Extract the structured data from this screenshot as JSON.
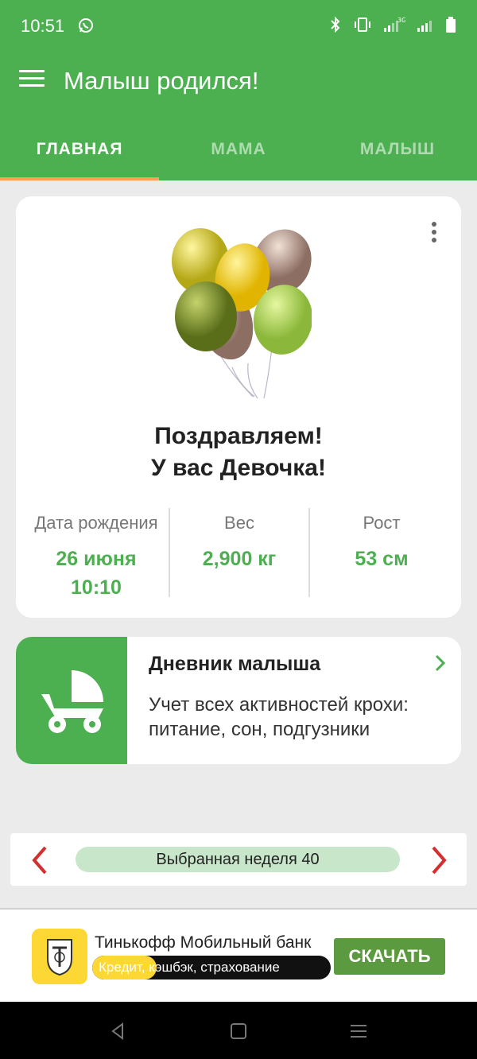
{
  "status_bar": {
    "time": "10:51",
    "icons": [
      "whatsapp-icon",
      "bluetooth-icon",
      "vibrate-icon",
      "signal-3g-icon",
      "signal-icon",
      "battery-icon"
    ]
  },
  "app_bar": {
    "title": "Малыш родился!",
    "menu_icon": "hamburger-menu-icon"
  },
  "tabs": [
    {
      "label": "ГЛАВНАЯ",
      "active": true
    },
    {
      "label": "МАМА",
      "active": false
    },
    {
      "label": "МАЛЫШ",
      "active": false
    }
  ],
  "birth_card": {
    "congrats_line1": "Поздравляем!",
    "congrats_line2": "У вас Девочка!",
    "stats": [
      {
        "label": "Дата рождения",
        "value_line1": "26 июня",
        "value_line2": "10:10"
      },
      {
        "label": "Вес",
        "value_line1": "2,900 кг",
        "value_line2": ""
      },
      {
        "label": "Рост",
        "value_line1": "53 см",
        "value_line2": ""
      }
    ]
  },
  "diary_card": {
    "title": "Дневник малыша",
    "description": "Учет всех активностей крохи: питание, сон, подгузники"
  },
  "week_selector": {
    "label": "Выбранная неделя 40"
  },
  "ad_banner": {
    "title": "Тинькофф Мобильный банк",
    "subtitle": "Кредит, кэшбэк, страхование",
    "cta": "СКАЧАТЬ",
    "progress": 0.27
  },
  "colors": {
    "primary": "#4caf50",
    "tab_indicator": "#ff9f5a",
    "accent_red": "#d32f2f",
    "week_pill": "#c8e6c9",
    "ad_button": "#5b9a3e"
  }
}
